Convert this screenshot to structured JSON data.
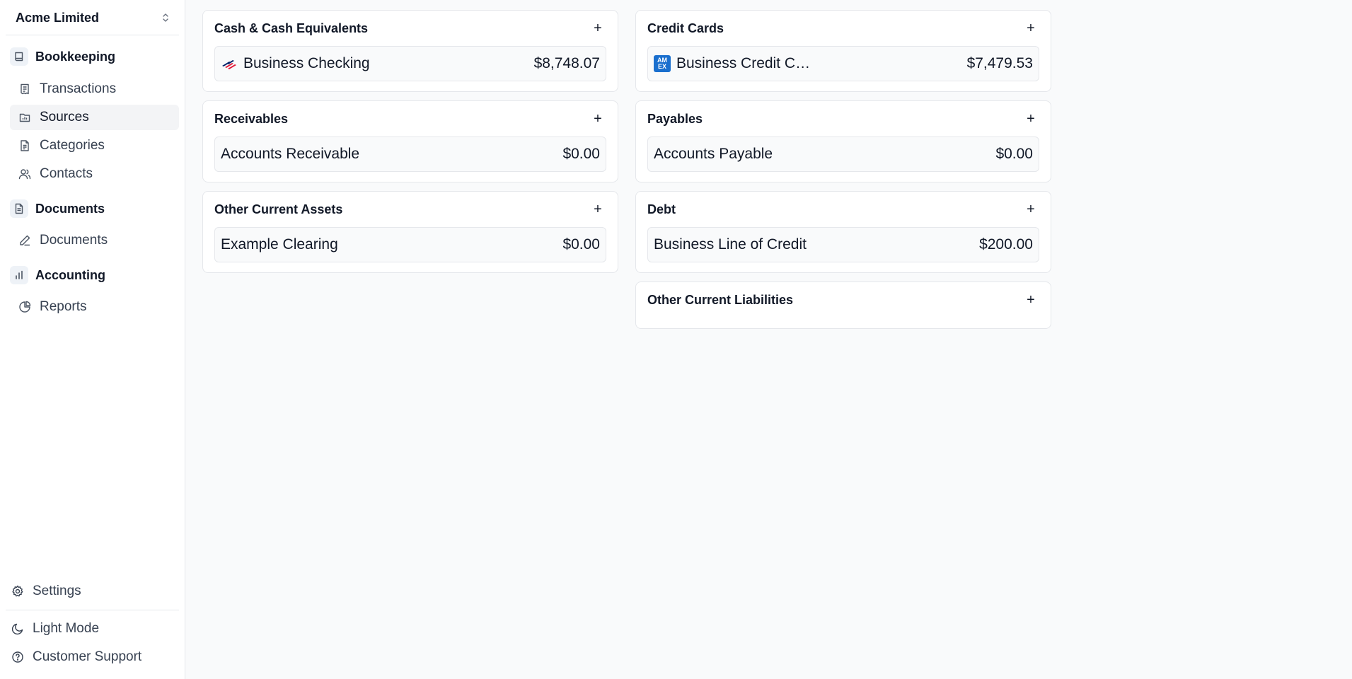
{
  "sidebar": {
    "org_name": "Acme Limited",
    "sections": [
      {
        "label": "Bookkeeping",
        "items": [
          {
            "label": "Transactions",
            "active": false
          },
          {
            "label": "Sources",
            "active": true
          },
          {
            "label": "Categories",
            "active": false
          },
          {
            "label": "Contacts",
            "active": false
          }
        ]
      },
      {
        "label": "Documents",
        "items": [
          {
            "label": "Documents",
            "active": false
          }
        ]
      },
      {
        "label": "Accounting",
        "items": [
          {
            "label": "Reports",
            "active": false
          }
        ]
      }
    ],
    "bottom": {
      "settings": "Settings",
      "theme": "Light Mode",
      "support": "Customer Support"
    }
  },
  "cards": {
    "cash": {
      "title": "Cash & Cash Equivalents",
      "accounts": [
        {
          "name": "Business Checking",
          "amount": "$8,748.07",
          "logo": "bank-flag-logo"
        }
      ]
    },
    "credit_cards": {
      "title": "Credit Cards",
      "accounts": [
        {
          "name": "Business Credit Card",
          "amount": "$7,479.53",
          "logo": "amex-logo",
          "logo_text": [
            "AM",
            "EX"
          ]
        }
      ]
    },
    "receivables": {
      "title": "Receivables",
      "accounts": [
        {
          "name": "Accounts Receivable",
          "amount": "$0.00"
        }
      ]
    },
    "payables": {
      "title": "Payables",
      "accounts": [
        {
          "name": "Accounts Payable",
          "amount": "$0.00"
        }
      ]
    },
    "other_current_assets": {
      "title": "Other Current Assets",
      "accounts": [
        {
          "name": "Example Clearing",
          "amount": "$0.00"
        }
      ]
    },
    "debt": {
      "title": "Debt",
      "accounts": [
        {
          "name": "Business Line of Credit",
          "amount": "$200.00"
        }
      ]
    },
    "other_current_liabilities": {
      "title": "Other Current Liabilities",
      "accounts": []
    }
  },
  "add_label": "+",
  "colors": {
    "background": "#f9fafb",
    "card_border": "#e5e7eb",
    "amex_blue": "#1a6fce",
    "bank_red": "#e31837",
    "bank_navy": "#012169"
  }
}
